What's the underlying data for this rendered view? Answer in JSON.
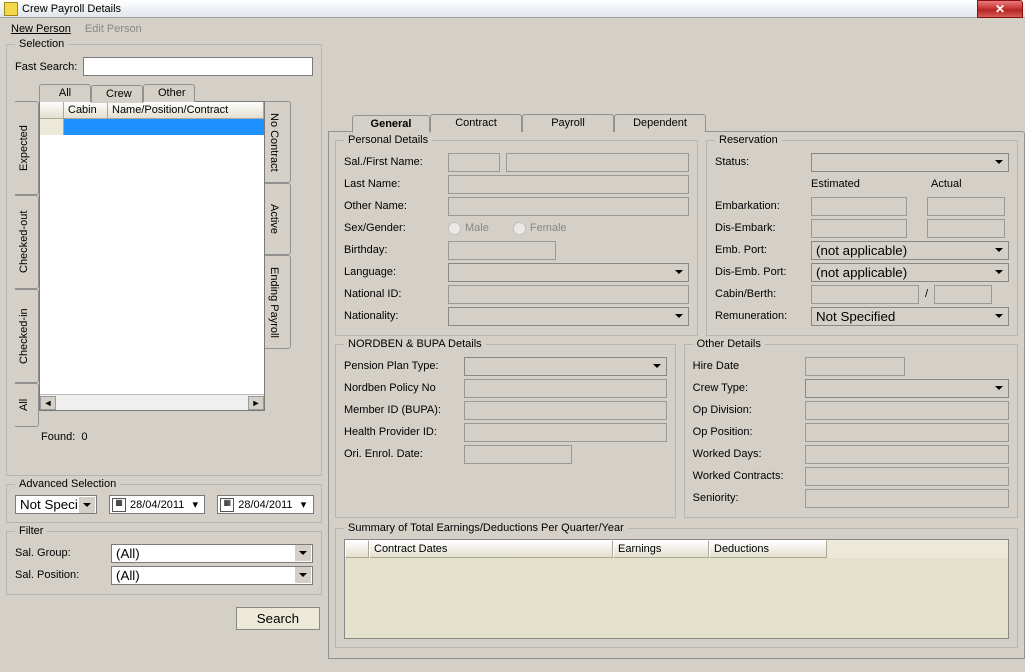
{
  "window": {
    "title": "Crew Payroll Details"
  },
  "menu": {
    "new_person": "New Person",
    "edit_person": "Edit Person"
  },
  "selection": {
    "legend": "Selection",
    "fast_label": "Fast Search:",
    "fast_value": "",
    "htabs": {
      "all": "All",
      "crew": "Crew",
      "other": "Other"
    },
    "grid_cols": {
      "cabin": "Cabin",
      "name": "Name/Position/Contract"
    },
    "left_tabs": {
      "expected": "Expected",
      "checked_out": "Checked-out",
      "checked_in": "Checked-in",
      "all": "All"
    },
    "right_tabs": {
      "no_contract": "No Contract",
      "active": "Active",
      "ending": "Ending Payroll"
    },
    "found_label": "Found:",
    "found_value": "0"
  },
  "advsel": {
    "legend": "Advanced Selection",
    "combo": "Not Specified",
    "date1": "28/04/2011",
    "date2": "28/04/2011"
  },
  "filter": {
    "legend": "Filter",
    "sal_group_label": "Sal. Group:",
    "sal_group_value": "(All)",
    "sal_position_label": "Sal. Position:",
    "sal_position_value": "(All)"
  },
  "search_btn": "Search",
  "right_tabs": {
    "general": "General",
    "contract": "Contract",
    "payroll": "Payroll",
    "dependent": "Dependent"
  },
  "personal": {
    "legend": "Personal Details",
    "sal_first": "Sal./First Name:",
    "last": "Last Name:",
    "other": "Other Name:",
    "sex": "Sex/Gender:",
    "male": "Male",
    "female": "Female",
    "birthday": "Birthday:",
    "language": "Language:",
    "national_id": "National ID:",
    "nationality": "Nationality:"
  },
  "reservation": {
    "legend": "Reservation",
    "status": "Status:",
    "estimated": "Estimated",
    "actual": "Actual",
    "embarkation": "Embarkation:",
    "disembark": "Dis-Embark:",
    "emb_port": "Emb. Port:",
    "emb_port_val": "(not applicable)",
    "disemb_port": "Dis-Emb. Port:",
    "disemb_port_val": "(not applicable)",
    "cabin": "Cabin/Berth:",
    "slash": "/",
    "remuneration": "Remuneration:",
    "remuneration_val": "Not Specified"
  },
  "nordben": {
    "legend": "NORDBEN & BUPA Details",
    "pension": "Pension Plan Type:",
    "policy": "Nordben Policy No",
    "member": "Member ID (BUPA):",
    "health": "Health Provider ID:",
    "ori": "Ori. Enrol. Date:"
  },
  "otherd": {
    "legend": "Other Details",
    "hire": "Hire Date",
    "crew_type": "Crew Type:",
    "op_div": "Op Division:",
    "op_pos": "Op Position:",
    "worked_days": "Worked Days:",
    "worked_contracts": "Worked Contracts:",
    "seniority": "Seniority:"
  },
  "summary": {
    "legend": "Summary of Total Earnings/Deductions Per Quarter/Year",
    "cols": {
      "contract": "Contract Dates",
      "earnings": "Earnings",
      "deductions": "Deductions"
    }
  }
}
